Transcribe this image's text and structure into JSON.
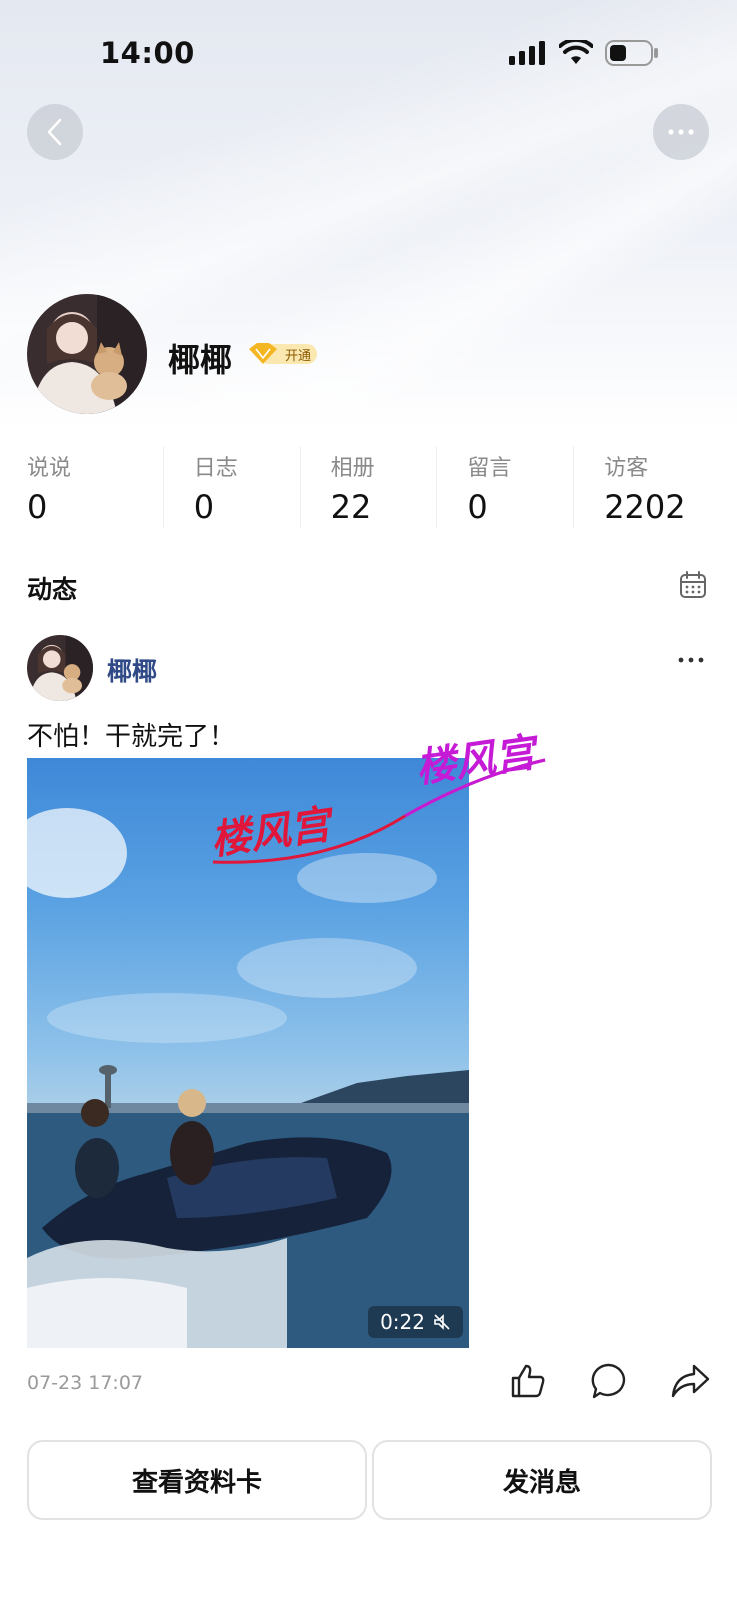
{
  "status_bar": {
    "time": "14:00"
  },
  "profile": {
    "name": "椰椰",
    "vip_label": "开通"
  },
  "stats": [
    {
      "label": "说说",
      "value": "0"
    },
    {
      "label": "日志",
      "value": "0"
    },
    {
      "label": "相册",
      "value": "22"
    },
    {
      "label": "留言",
      "value": "0"
    },
    {
      "label": "访客",
      "value": "2202"
    }
  ],
  "feed": {
    "title": "动态",
    "post": {
      "author": "椰椰",
      "text": "不怕！干就完了！",
      "video_duration": "0:22",
      "watermark_1": "楼风宫",
      "watermark_2": "楼风宫",
      "date": "07-23 17:07"
    }
  },
  "buttons": {
    "view_card": "查看资料卡",
    "send_message": "发消息"
  },
  "icons": {
    "back": "chevron-left-icon",
    "more": "more-icon",
    "calendar": "calendar-icon",
    "like": "thumbs-up-icon",
    "comment": "comment-icon",
    "share": "share-icon",
    "mute": "mute-icon"
  }
}
